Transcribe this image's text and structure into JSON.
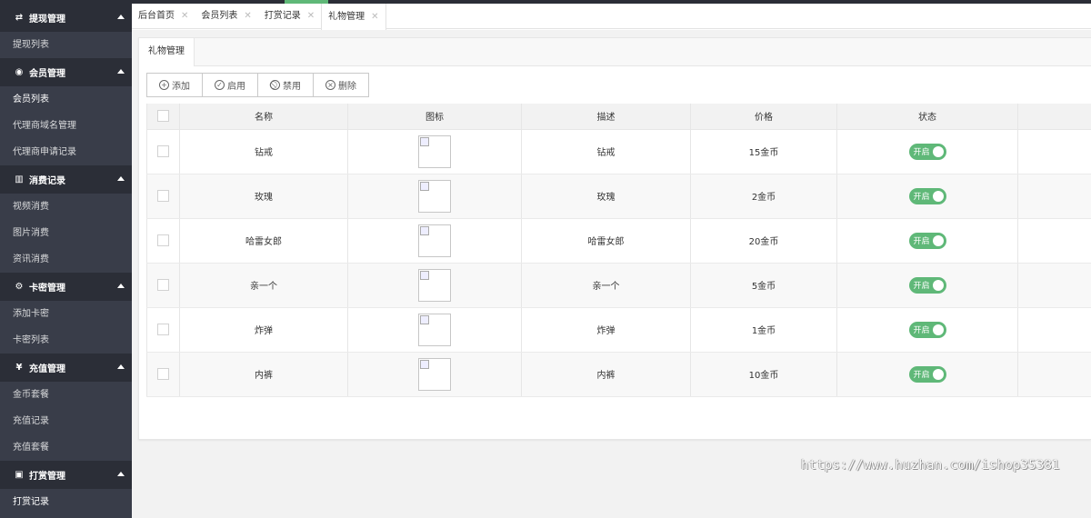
{
  "sidebar": {
    "groups": [
      {
        "title": "提现管理",
        "icon": "swap-icon",
        "items": [
          "提现列表"
        ]
      },
      {
        "title": "会员管理",
        "icon": "user-circle-icon",
        "items": [
          "会员列表",
          "代理商域名管理",
          "代理商申请记录"
        ]
      },
      {
        "title": "消费记录",
        "icon": "bar-chart-icon",
        "items": [
          "视频消费",
          "图片消费",
          "资讯消费"
        ]
      },
      {
        "title": "卡密管理",
        "icon": "gear-icon",
        "items": [
          "添加卡密",
          "卡密列表"
        ]
      },
      {
        "title": "充值管理",
        "icon": "yen-icon",
        "items": [
          "金币套餐",
          "充值记录",
          "充值套餐"
        ]
      },
      {
        "title": "打赏管理",
        "icon": "camera-icon",
        "items": [
          "打赏记录"
        ]
      }
    ]
  },
  "tabs": [
    {
      "label": "后台首页"
    },
    {
      "label": "会员列表"
    },
    {
      "label": "打赏记录"
    },
    {
      "label": "礼物管理"
    }
  ],
  "card": {
    "tab_label": "礼物管理"
  },
  "toolbar": {
    "add": "添加",
    "enable": "启用",
    "disable": "禁用",
    "delete": "删除"
  },
  "table": {
    "headers": [
      "名称",
      "图标",
      "描述",
      "价格",
      "状态"
    ],
    "rows": [
      {
        "name": "钻戒",
        "desc": "钻戒",
        "price": "15金币",
        "status": "开启"
      },
      {
        "name": "玫瑰",
        "desc": "玫瑰",
        "price": "2金币",
        "status": "开启"
      },
      {
        "name": "哈雷女郎",
        "desc": "哈雷女郎",
        "price": "20金币",
        "status": "开启"
      },
      {
        "name": "亲一个",
        "desc": "亲一个",
        "price": "5金币",
        "status": "开启"
      },
      {
        "name": "炸弹",
        "desc": "炸弹",
        "price": "1金币",
        "status": "开启"
      },
      {
        "name": "内裤",
        "desc": "内裤",
        "price": "10金币",
        "status": "开启"
      }
    ]
  },
  "watermark": "https://www.huzhan.com/ishop35381",
  "colors": {
    "sidebar_bg": "#393d49",
    "sidebar_header_bg": "#2b2e37",
    "switch_on": "#5fb878"
  }
}
